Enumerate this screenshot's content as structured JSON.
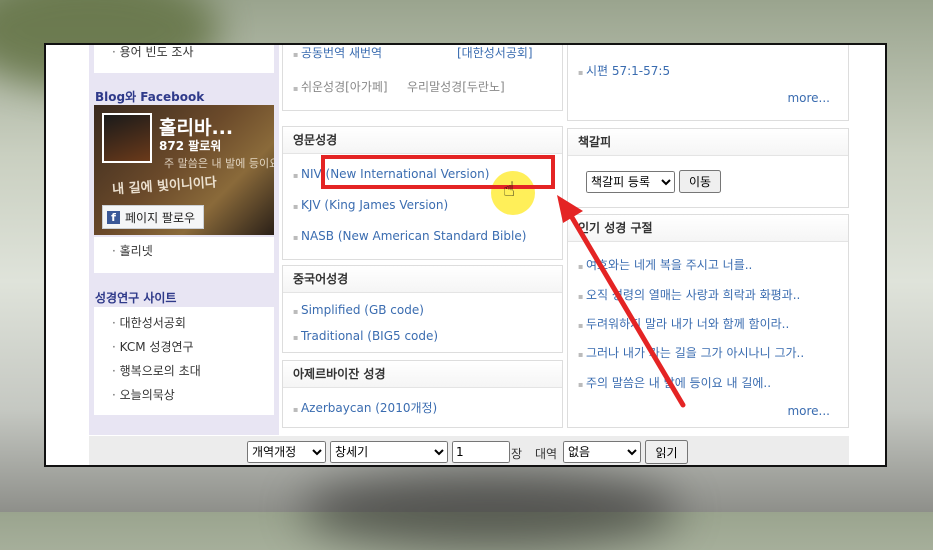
{
  "left": {
    "top_item": "용어 빈도 조사",
    "blog_title": "Blog와 Facebook",
    "fb": {
      "page_name": "홀리바...",
      "followers": "872 팔로워",
      "art_line1": "내 길에 빛이니이다",
      "art_line2": "주 말씀은 내 발에 등이요",
      "follow_button": "페이지 팔로우"
    },
    "blog_items": [
      "홀리넷"
    ],
    "research_title": "성경연구 사이트",
    "research_items": [
      "대한성서공회",
      "KCM 성경연구",
      "행복으로의 초대",
      "오늘의묵상"
    ]
  },
  "middle": {
    "korean_partial_items": [
      {
        "left": "공동번역 새번역",
        "right": "[대한성서공회]"
      },
      {
        "left": "쉬운성경[아가페]",
        "right": "우리말성경[두란노]"
      }
    ],
    "english": {
      "title": "영문성경",
      "items": [
        "NIV (New International Version)",
        "KJV (King James Version)",
        "NASB (New American Standard Bible)"
      ]
    },
    "chinese": {
      "title": "중국어성경",
      "items": [
        "Simplified (GB code)",
        "Traditional (BIG5 code)"
      ]
    },
    "azeri": {
      "title": "아제르바이잔 성경",
      "items": [
        "Azerbaycan (2010개정)"
      ]
    }
  },
  "right": {
    "top_partial_item": "시편 57:1-57:5",
    "more_label": "more...",
    "bookmark": {
      "title": "책갈피",
      "select_value": "책갈피 등록",
      "go_button": "이동"
    },
    "popular": {
      "title": "인기 성경 구절",
      "items": [
        "여호와는 네게 복을 주시고 너를..",
        "오직 성령의 열매는 사랑과 희락과 화평과..",
        "두려워하지 말라 내가 너와 함께 함이라..",
        "그러나 내가 가는 길을 그가 아시나니 그가..",
        "주의 말씀은 내 발에 등이요 내 길에.."
      ],
      "more_label": "more..."
    }
  },
  "bottom_bar": {
    "version_select": "개역개정",
    "book_select": "창세기",
    "chapter_value": "1",
    "chapter_label": "장",
    "compare_label": "대역",
    "compare_select": "없음",
    "read_button": "읽기"
  },
  "annotation": {
    "highlight_color": "#e42424",
    "arrow_color": "#e42424",
    "cursor": "hand-pointer-icon"
  },
  "colors": {
    "link": "#3a6cb0",
    "left_title": "#2f3a8a",
    "left_panel_bg": "#e8e5f3"
  }
}
